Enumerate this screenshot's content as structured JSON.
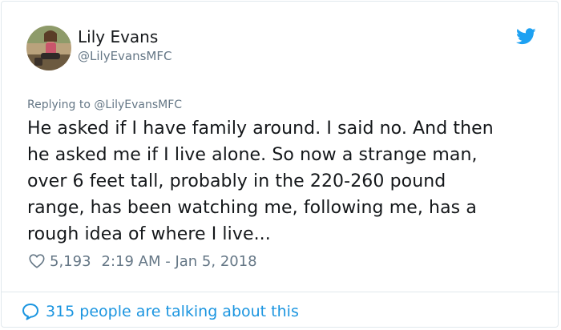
{
  "user": {
    "display_name": "Lily Evans",
    "handle": "@LilyEvansMFC"
  },
  "reply_context": {
    "prefix": "Replying to ",
    "mention": "@LilyEvansMFC"
  },
  "tweet": {
    "lines": [
      "He asked if I have family around. I said no. And then",
      "he asked me if I live alone. So now a strange man,",
      "over 6 feet tall, probably in the 220-260 pound",
      "range, has been watching me, following me, has a",
      "rough idea of where I live..."
    ]
  },
  "meta": {
    "likes": "5,193",
    "timestamp": "2:19 AM - Jan 5, 2018"
  },
  "footer": {
    "talking": "315 people are talking about this"
  },
  "icons": {
    "brand": "twitter-bird-icon",
    "like": "heart-icon",
    "conversation": "speech-bubble-icon"
  },
  "colors": {
    "text": "#14171a",
    "secondary": "#657786",
    "accent": "#1b95e0",
    "border": "#e1e8ed"
  }
}
